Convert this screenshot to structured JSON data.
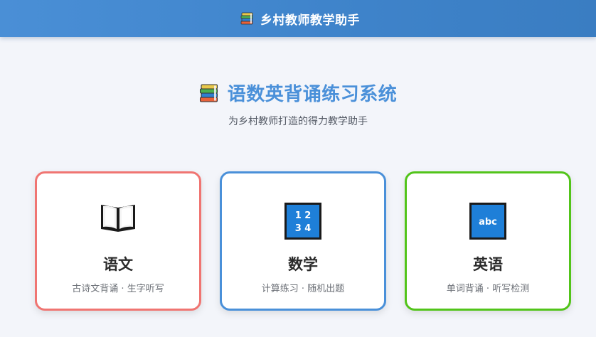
{
  "header": {
    "icon": "books-icon",
    "title": "乡村教师教学助手"
  },
  "hero": {
    "icon": "books-icon",
    "title": "语数英背诵练习系统",
    "subtitle": "为乡村教师打造的得力教学助手"
  },
  "cards": [
    {
      "icon": "open-book-icon",
      "name": "语文",
      "desc": "古诗文背诵 · 生字听写",
      "color": "#f07572"
    },
    {
      "icon": "numbers-icon",
      "icon_text_line1": "1 2",
      "icon_text_line2": "3 4",
      "name": "数学",
      "desc": "计算练习 · 随机出题",
      "color": "#4a90d9"
    },
    {
      "icon": "abc-icon",
      "icon_text": "abc",
      "name": "英语",
      "desc": "单词背诵 · 听写检测",
      "color": "#52c41a"
    }
  ],
  "colors": {
    "header_bg": "#4a8fd6",
    "title_blue": "#4a90d9",
    "page_bg": "#f3f5fa"
  }
}
